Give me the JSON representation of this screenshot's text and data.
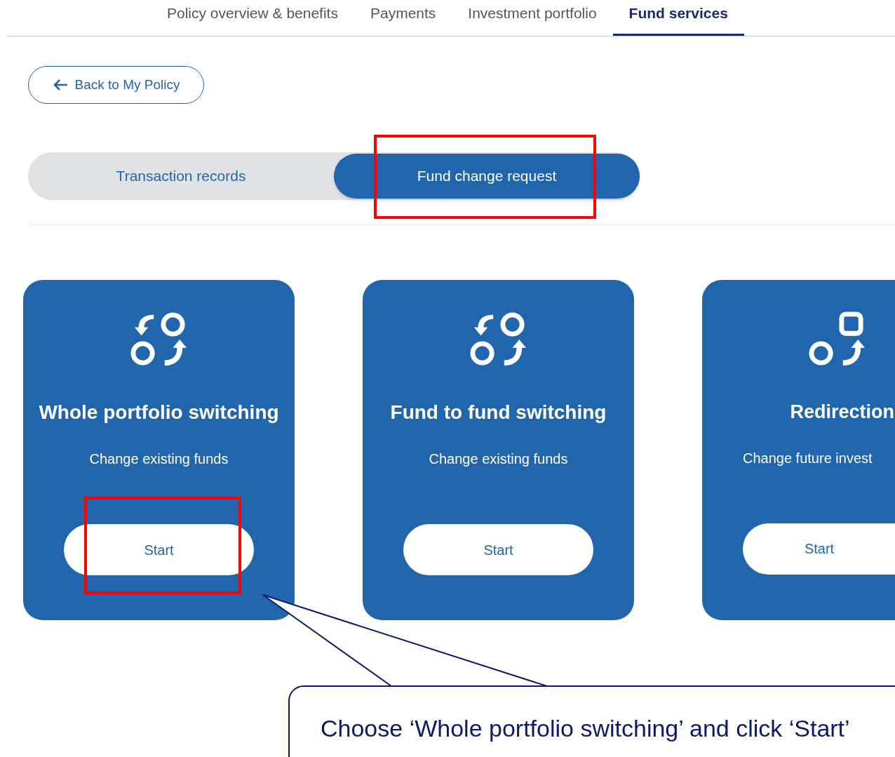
{
  "nav_tabs": [
    {
      "label": "Policy overview & benefits",
      "selected": false
    },
    {
      "label": "Payments",
      "selected": false
    },
    {
      "label": "Investment portfolio",
      "selected": false
    },
    {
      "label": "Fund services",
      "selected": true
    }
  ],
  "back_button": {
    "label": "Back to My Policy"
  },
  "segments": [
    {
      "label": "Transaction records",
      "selected": false
    },
    {
      "label": "Fund change request",
      "selected": true
    }
  ],
  "cards": [
    {
      "kind": "switch",
      "title": "Whole portfolio switching",
      "subtitle": "Change existing funds",
      "button": "Start"
    },
    {
      "kind": "switch",
      "title": "Fund to fund switching",
      "subtitle": "Change existing funds",
      "button": "Start"
    },
    {
      "kind": "redirect",
      "title": "Redirection",
      "subtitle": "Change future invest",
      "button": "Start"
    }
  ],
  "callout": {
    "text": "Choose ‘Whole portfolio switching’ and click ‘Start’"
  }
}
